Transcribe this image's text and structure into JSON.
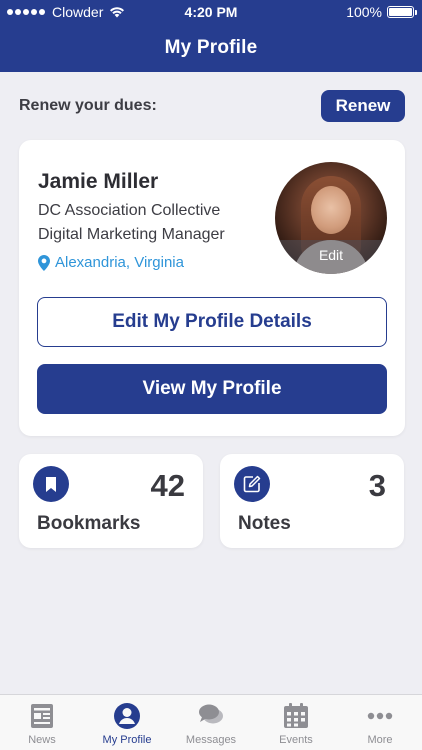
{
  "status_bar": {
    "carrier": "Clowder",
    "time": "4:20 PM",
    "battery": "100%"
  },
  "header": {
    "title": "My Profile"
  },
  "renew": {
    "label": "Renew your dues:",
    "button_label": "Renew"
  },
  "profile": {
    "name": "Jamie Miller",
    "organization": "DC Association Collective",
    "job_title": "Digital Marketing Manager",
    "location": "Alexandria, Virginia",
    "avatar_edit_label": "Edit",
    "edit_button_label": "Edit My Profile Details",
    "view_button_label": "View My Profile"
  },
  "stats": [
    {
      "label": "Bookmarks",
      "count": "42",
      "icon": "bookmark-icon"
    },
    {
      "label": "Notes",
      "count": "3",
      "icon": "edit-note-icon"
    }
  ],
  "tabbar": {
    "items": [
      {
        "label": "News",
        "icon": "news-icon",
        "active": false
      },
      {
        "label": "My Profile",
        "icon": "profile-icon",
        "active": true
      },
      {
        "label": "Messages",
        "icon": "messages-icon",
        "active": false
      },
      {
        "label": "Events",
        "icon": "calendar-icon",
        "active": false
      },
      {
        "label": "More",
        "icon": "more-icon",
        "active": false
      }
    ]
  },
  "colors": {
    "brand": "#263d8f",
    "location_link": "#2f95d9",
    "background": "#eeeef3",
    "inactive_tab": "#8e8e93"
  }
}
